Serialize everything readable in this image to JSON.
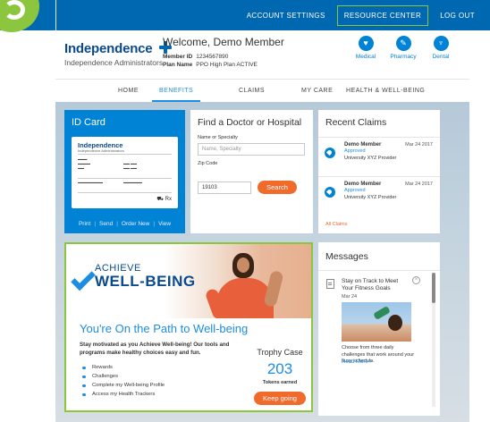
{
  "topbar": {
    "links": [
      "ACCOUNT SETTINGS",
      "RESOURCE CENTER",
      "LOG OUT"
    ],
    "active": "RESOURCE CENTER"
  },
  "header": {
    "logo_name": "Independence",
    "logo_sub": "Independence Administrators",
    "welcome": "Welcome, Demo Member",
    "member_id_label": "Member ID",
    "member_id": "1234567890",
    "plan_name_label": "Plan Name",
    "plan_name": "PPO High Plan ACTIVE",
    "icons": [
      {
        "label": "Medical",
        "icon": "heart-icon"
      },
      {
        "label": "Pharmacy",
        "icon": "pill-icon"
      },
      {
        "label": "Dental",
        "icon": "tooth-icon"
      }
    ]
  },
  "nav": {
    "items": [
      "HOME",
      "BENEFITS",
      "CLAIMS",
      "MY CARE",
      "HEALTH & WELL-BEING"
    ],
    "active": "BENEFITS"
  },
  "id_card": {
    "title": "ID Card",
    "card_logo": "Independence",
    "card_logo_sub": "Independence Administrators",
    "card_rx": "Rx",
    "actions": [
      "Print",
      "Send",
      "Order New",
      "View"
    ]
  },
  "find_doctor": {
    "title": "Find a Doctor or Hospital",
    "name_label": "Name or Specialty",
    "name_placeholder": "Name, Specialty",
    "zip_label": "Zip Code",
    "zip_value": "19103",
    "search_label": "Search"
  },
  "recent_claims": {
    "title": "Recent Claims",
    "claims": [
      {
        "name": "Demo Member",
        "status": "Approved",
        "provider": "University XYZ Provider",
        "date": "Mar 24 2017"
      },
      {
        "name": "Demo Member",
        "status": "Approved",
        "provider": "University XYZ Provider",
        "date": "Mar 24 2017"
      }
    ],
    "all_claims_label": "All Claims"
  },
  "wellbeing": {
    "achieve": "ACHIEVE",
    "wellbeing": "WELL-BEING",
    "heading": "You're On the Path to Well-being",
    "intro": "Stay motivated as you Achieve Well-being! Our tools and programs make healthy choices easy and fun.",
    "list": [
      "Rewards",
      "Challenges",
      "Complete my Well-being Profile",
      "Access my Health Trackers"
    ],
    "trophy_title": "Trophy Case",
    "tokens_value": "203",
    "tokens_label": "Tokens earned",
    "keep_going_label": "Keep going"
  },
  "messages": {
    "title": "Messages",
    "item": {
      "headline": "Stay on Track to Meet Your Fitness Goals",
      "date": "Mar 24",
      "body": "Choose from three daily challenges that work around your busy schedule.",
      "read_more": "Read More >"
    }
  },
  "colors": {
    "brand_blue": "#0067b1",
    "accent_blue": "#1d8de3",
    "accent_green": "#8cc63f",
    "accent_orange": "#ef6a2b"
  }
}
